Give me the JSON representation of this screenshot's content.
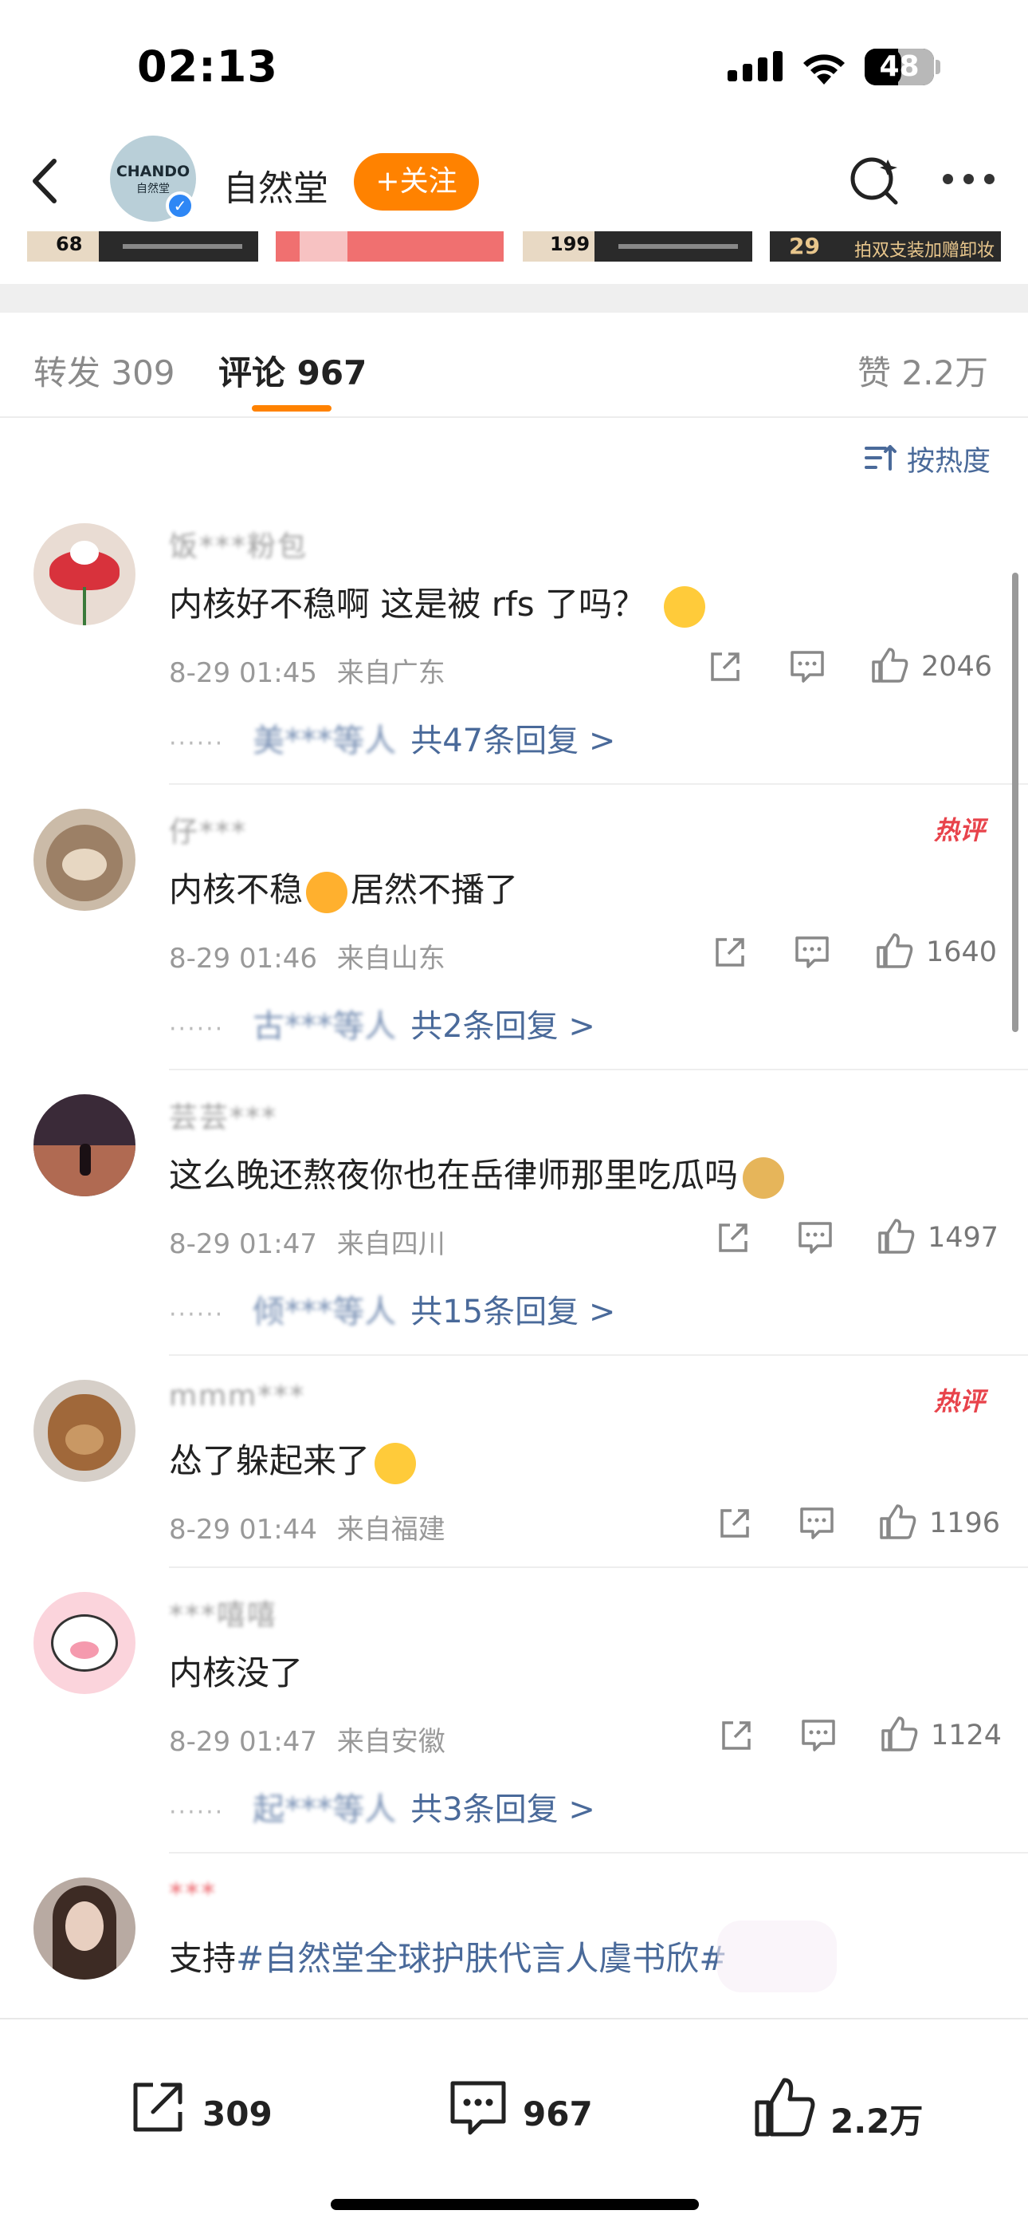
{
  "status_bar": {
    "time": "02:13",
    "battery": "48"
  },
  "header": {
    "account_name": "自然堂",
    "logo_text_top": "CHANDO",
    "logo_text_bottom": "自然堂",
    "follow_label": "+关注"
  },
  "banner": {
    "items": [
      "68",
      "199",
      "29",
      "拍双支装加赠卸妆水"
    ]
  },
  "tabs": {
    "repost": "转发 309",
    "comment": "评论 967",
    "likes": "赞 2.2万"
  },
  "sort_label": "按热度",
  "comments": [
    {
      "username": "饭***粉包",
      "text": "内核好不稳啊 这是被 rfs 了吗？",
      "time": "8-29 01:45",
      "location": "来自广东",
      "likes": "2046",
      "hot": false,
      "replies_names": "美***等人",
      "replies_count": "共47条回复 >"
    },
    {
      "username": "仔***",
      "text": "内核不稳",
      "text2": "居然不播了",
      "time": "8-29 01:46",
      "location": "来自山东",
      "likes": "1640",
      "hot": true,
      "hot_label": "热评",
      "replies_names": "古***等人",
      "replies_count": "共2条回复 >"
    },
    {
      "username": "芸芸***",
      "text": "这么晚还熬夜你也在岳律师那里吃瓜吗",
      "time": "8-29 01:47",
      "location": "来自四川",
      "likes": "1497",
      "hot": false,
      "replies_names": "倾***等人",
      "replies_count": "共15条回复 >"
    },
    {
      "username": "mmm***",
      "text": "怂了躲起来了",
      "time": "8-29 01:44",
      "location": "来自福建",
      "likes": "1196",
      "hot": true,
      "hot_label": "热评"
    },
    {
      "username": "***嘻嘻",
      "text": "内核没了",
      "time": "8-29 01:47",
      "location": "来自安徽",
      "likes": "1124",
      "hot": false,
      "replies_names": "起***等人",
      "replies_count": "共3条回复 >"
    },
    {
      "username": "***",
      "text_prefix": "支持",
      "hashtag": "#自然堂全球护肤代言人虞书欣#"
    }
  ],
  "bottom_bar": {
    "repost_count": "309",
    "comment_count": "967",
    "like_count": "2.2万"
  },
  "colors": {
    "accent": "#ff8200",
    "link": "#4a6a9a",
    "hot": "#e8434b"
  }
}
